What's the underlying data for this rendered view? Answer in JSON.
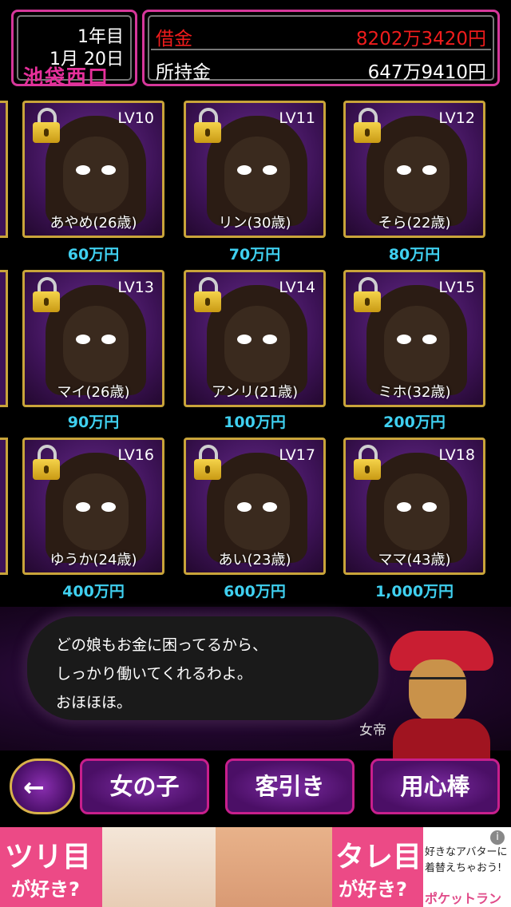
{
  "header": {
    "year": "1年目",
    "date": "1月 20日",
    "location": "池袋西口",
    "debt_label": "借金",
    "debt_value": "8202万3420円",
    "cash_label": "所持金",
    "cash_value": "647万9410円"
  },
  "girls": [
    {
      "level": "LV10",
      "name": "あやめ(26歳)",
      "price": "60万円"
    },
    {
      "level": "LV11",
      "name": "リン(30歳)",
      "price": "70万円"
    },
    {
      "level": "LV12",
      "name": "そら(22歳)",
      "price": "80万円"
    },
    {
      "level": "LV13",
      "name": "マイ(26歳)",
      "price": "90万円"
    },
    {
      "level": "LV14",
      "name": "アンリ(21歳)",
      "price": "100万円"
    },
    {
      "level": "LV15",
      "name": "ミホ(32歳)",
      "price": "200万円"
    },
    {
      "level": "LV16",
      "name": "ゆうか(24歳)",
      "price": "400万円"
    },
    {
      "level": "LV17",
      "name": "あい(23歳)",
      "price": "600万円"
    },
    {
      "level": "LV18",
      "name": "ママ(43歳)",
      "price": "1,000万円"
    }
  ],
  "dialog": {
    "lines": [
      "どの娘もお金に困ってるから、",
      "しっかり働いてくれるわよ。",
      "おほほほ。"
    ],
    "speaker": "女帝"
  },
  "nav": {
    "back_icon": "←",
    "girls_label": "女の子",
    "touting_label": "客引き",
    "bodyguard_label": "用心棒"
  },
  "ad": {
    "left_big": "ツリ目",
    "left_small": "が好き?",
    "right_big": "タレ目",
    "right_small": "が好き?",
    "tagline_1": "好きなアバターに",
    "tagline_2": "着替えちゃおう!",
    "logo": "ポケットランド",
    "info_icon": "i"
  },
  "colors": {
    "debt": "#f01c1c",
    "price": "#3fd0f0",
    "frame": "#c9a43a",
    "accent": "#d6379a"
  }
}
